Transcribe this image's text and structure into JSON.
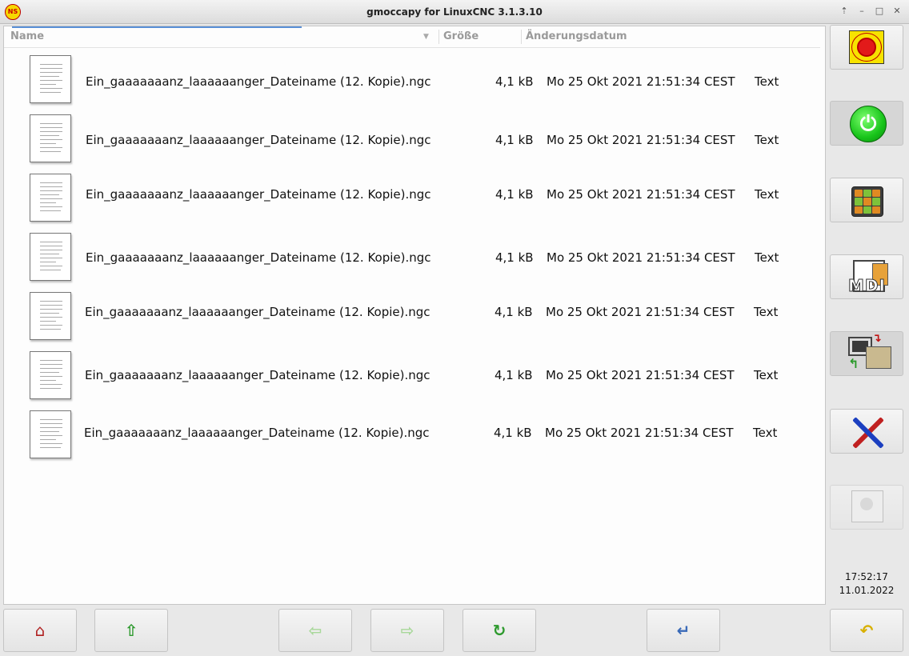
{
  "window": {
    "title": "gmoccapy for LinuxCNC  3.1.3.10",
    "logo_text": "NS",
    "controls": [
      "⇡",
      "–",
      "□",
      "✕"
    ]
  },
  "file_table": {
    "columns": {
      "name": "Name",
      "size": "Größe",
      "modified": "Änderungsdatum"
    },
    "rows": [
      {
        "name": "Ein_gaaaaaaanz_laaaaaanger_Dateiname (12. Kopie).ngc",
        "size": "4,1 kB",
        "modified": "Mo 25 Okt 2021 21:51:34 CEST",
        "type": "Text"
      },
      {
        "name": "Ein_gaaaaaaanz_laaaaaanger_Dateiname (12. Kopie).ngc",
        "size": "4,1 kB",
        "modified": "Mo 25 Okt 2021 21:51:34 CEST",
        "type": "Text"
      },
      {
        "name": "Ein_gaaaaaaanz_laaaaaanger_Dateiname (12. Kopie).ngc",
        "size": "4,1 kB",
        "modified": "Mo 25 Okt 2021 21:51:34 CEST",
        "type": "Text"
      },
      {
        "name": "Ein_gaaaaaaanz_laaaaaanger_Dateiname (12. Kopie).ngc",
        "size": "4,1 kB",
        "modified": "Mo 25 Okt 2021 21:51:34 CEST",
        "type": "Text"
      },
      {
        "name": "Ein_gaaaaaaanz_laaaaaanger_Dateiname (12. Kopie).ngc",
        "size": "4,1 kB",
        "modified": "Mo 25 Okt 2021 21:51:34 CEST",
        "type": "Text"
      },
      {
        "name": "Ein_gaaaaaaanz_laaaaaanger_Dateiname (12. Kopie).ngc",
        "size": "4,1 kB",
        "modified": "Mo 25 Okt 2021 21:51:34 CEST",
        "type": "Text"
      },
      {
        "name": "Ein_gaaaaaaanz_laaaaaanger_Dateiname (12. Kopie).ngc",
        "size": "4,1 kB",
        "modified": "Mo 25 Okt 2021 21:51:34 CEST",
        "type": "Text"
      }
    ]
  },
  "sidebar": {
    "buttons": [
      {
        "icon": "emergency-stop-icon",
        "label": "Emergency Stop"
      },
      {
        "icon": "power-on-icon"
      },
      {
        "icon": "jog-manual-icon"
      },
      {
        "icon": "mdi-icon",
        "label": "MDI"
      },
      {
        "icon": "auto-mode-icon"
      },
      {
        "icon": "tools-settings-icon"
      },
      {
        "icon": "user-tabs-icon"
      }
    ]
  },
  "clock": {
    "time": "17:52:17",
    "date": "11.01.2022"
  },
  "bottom_bar": {
    "buttons": [
      "home-icon",
      "arrow-up-icon",
      "arrow-left-icon",
      "arrow-right-icon",
      "reload-icon",
      "select-enter-icon",
      "back-icon"
    ]
  },
  "icons": {
    "home": "⌂",
    "up": "⇧",
    "left": "⇦",
    "right": "⇨",
    "reload": "↻",
    "enter": "↵",
    "back": "↶",
    "power": "⏻"
  },
  "colors": {
    "estop_yellow": "#f7e300",
    "estop_red": "#e21a1a",
    "power_green": "#18c41a",
    "accent_blue": "#5a8fd6"
  }
}
